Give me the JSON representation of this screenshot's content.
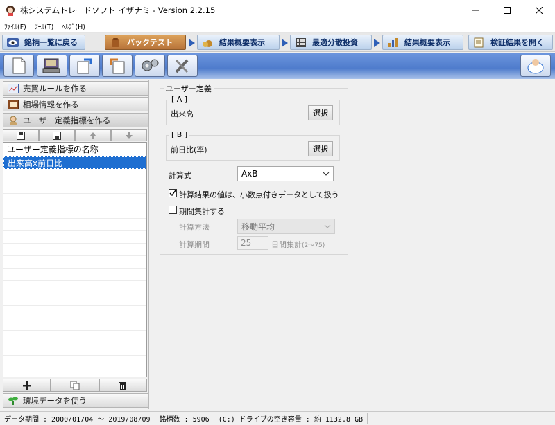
{
  "window": {
    "title": "株システムトレードソフト イザナミ - Version 2.2.15"
  },
  "menu": [
    {
      "label": "ﾌｧｲﾙ(F)"
    },
    {
      "label": "ﾂｰﾙ(T)"
    },
    {
      "label": "ﾍﾙﾌﾟ(H)"
    }
  ],
  "tabs": [
    {
      "label": "銘柄一覧に戻る",
      "active": false
    },
    {
      "label": "バックテスト",
      "active": true
    },
    {
      "label": "結果概要表示",
      "active": false
    },
    {
      "label": "最適分散投資",
      "active": false
    },
    {
      "label": "結果概要表示",
      "active": false
    },
    {
      "label": "検証結果を開く",
      "active": false
    }
  ],
  "sidebar": {
    "buttons": [
      {
        "label": "売買ルールを作る"
      },
      {
        "label": "相場情報を作る"
      },
      {
        "label": "ユーザー定義指標を作る"
      }
    ],
    "bottom_button": "環境データを使う"
  },
  "indicator_list": {
    "header": "ユーザー定義指標の名称",
    "items": [
      "出来高x前日比"
    ]
  },
  "form": {
    "group_title": "ユーザー定義",
    "a_label": "[ A ]",
    "a_value": "出来高",
    "b_label": "[ B ]",
    "b_value": "前日比(率)",
    "select_label": "選択",
    "formula_label": "計算式",
    "formula_value": "AxB",
    "decimal_checkbox_label": "計算結果の値は、小数点付きデータとして扱う",
    "decimal_checked": true,
    "period_checkbox_label": "期間集計する",
    "period_checked": false,
    "calc_method_label": "計算方法",
    "calc_method_value": "移動平均",
    "calc_period_label": "計算期間",
    "calc_period_value": "25",
    "calc_period_suffix": "日間集計",
    "calc_period_range": "(2〜75)"
  },
  "status": {
    "data_period": "データ期間 : 2000/01/04 〜 2019/08/09",
    "stock_count": "銘柄数 : 5906",
    "drive_space": "(C:) ドライブの空き容量 : 約 1132.8 GB"
  }
}
